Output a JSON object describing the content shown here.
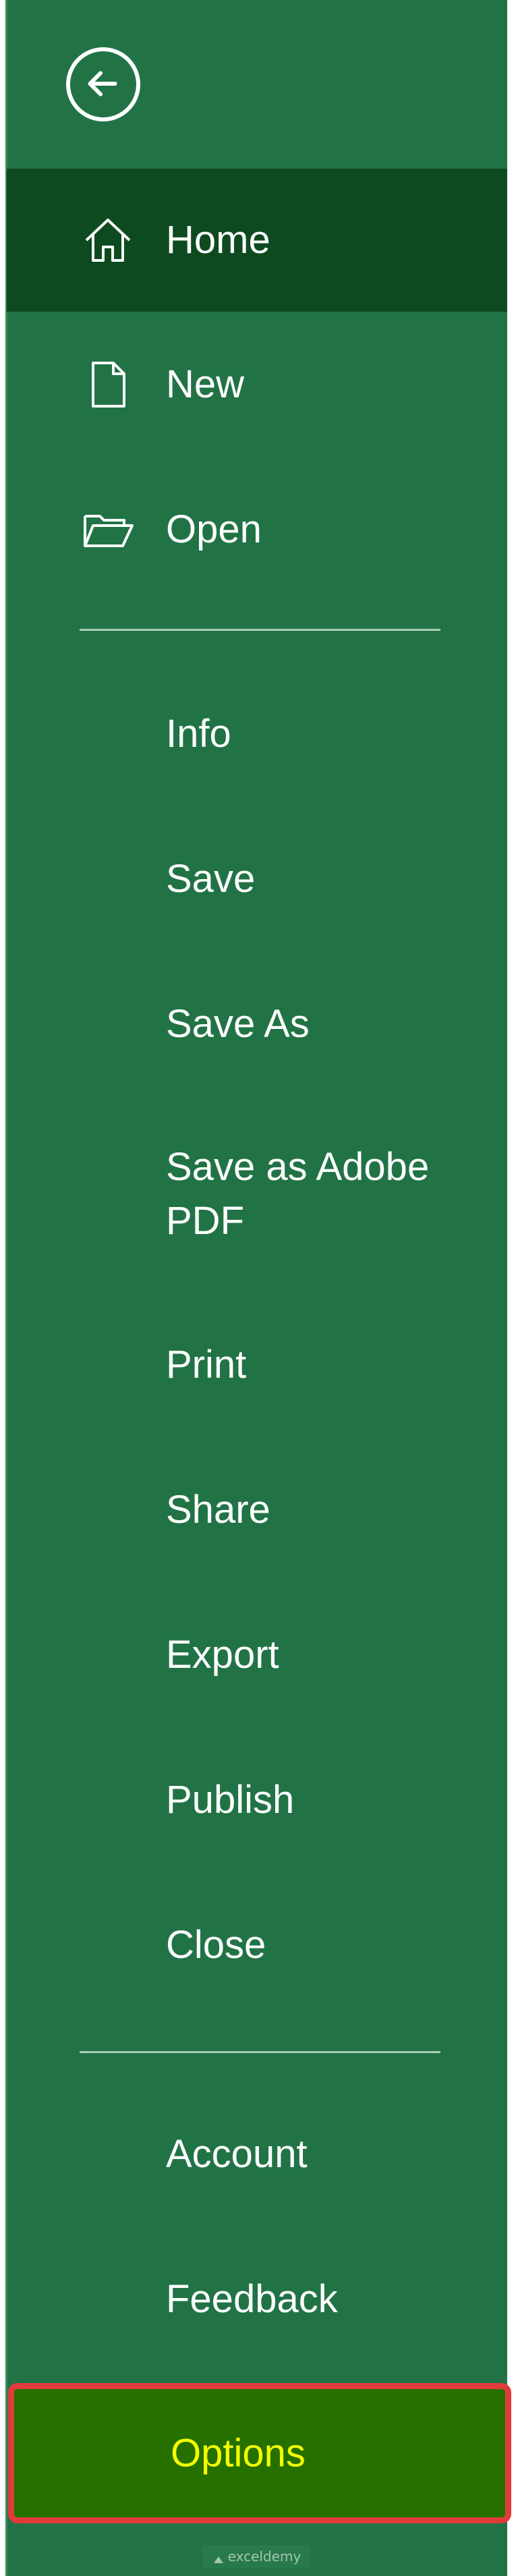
{
  "menu": {
    "back_icon": "back-arrow-icon",
    "items": {
      "home": "Home",
      "new": "New",
      "open": "Open",
      "info": "Info",
      "save": "Save",
      "save_as": "Save As",
      "save_as_pdf": "Save as Adobe PDF",
      "print": "Print",
      "share": "Share",
      "export": "Export",
      "publish": "Publish",
      "close": "Close",
      "account": "Account",
      "feedback": "Feedback",
      "options": "Options"
    }
  },
  "watermark": {
    "text": "exceldemy"
  },
  "colors": {
    "background": "#217346",
    "selected": "#0e4a20",
    "options_background": "#267000",
    "options_text": "#f4ff00",
    "highlight_border": "#e23b3b"
  }
}
